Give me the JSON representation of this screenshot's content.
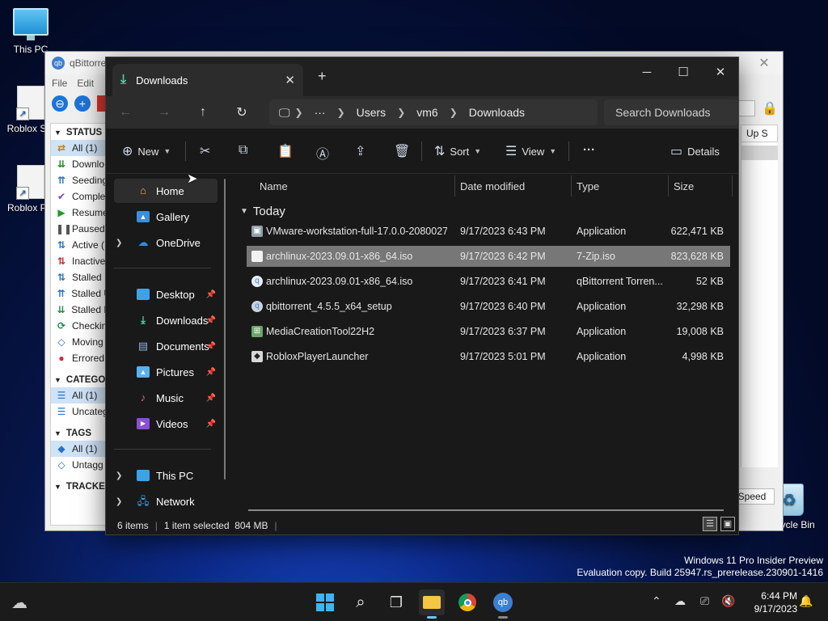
{
  "desktop": {
    "icons": [
      {
        "label": "This PC"
      },
      {
        "label": "Roblox Stu"
      },
      {
        "label": "Roblox Pla"
      },
      {
        "label": "Recycle Bin"
      }
    ],
    "watermark_line1": "Windows 11 Pro Insider Preview",
    "watermark_line2": "Evaluation copy. Build 25947.rs_prerelease.230901-1416"
  },
  "qbittorrent": {
    "title": "qBittorre",
    "menu": [
      "File",
      "Edit"
    ],
    "right_header": "Up S",
    "speed_button": "Speed",
    "sections": {
      "status": "STATUS",
      "categories": "CATEGO",
      "tags": "TAGS",
      "trackers": "TRACKER"
    },
    "status_items": [
      "All (1)",
      "Downlo",
      "Seeding",
      "Comple",
      "Resume",
      "Paused",
      "Active (",
      "Inactive",
      "Stalled",
      "Stalled U",
      "Stalled D",
      "Checkin",
      "Moving",
      "Errored"
    ],
    "category_items": [
      "All (1)",
      "Uncateg"
    ],
    "tag_items": [
      "All (1)",
      "Untagg"
    ]
  },
  "explorer": {
    "tab_title": "Downloads",
    "address": [
      "Users",
      "vm6",
      "Downloads"
    ],
    "address_more": "···",
    "search_placeholder": "Search Downloads",
    "commands": {
      "new": "New",
      "sort": "Sort",
      "view": "View",
      "more": "···",
      "details": "Details"
    },
    "nav": {
      "home": "Home",
      "gallery": "Gallery",
      "onedrive": "OneDrive",
      "desktop": "Desktop",
      "downloads": "Downloads",
      "documents": "Documents",
      "pictures": "Pictures",
      "music": "Music",
      "videos": "Videos",
      "thispc": "This PC",
      "network": "Network"
    },
    "columns": {
      "name": "Name",
      "date": "Date modified",
      "type": "Type",
      "size": "Size"
    },
    "group": "Today",
    "files": [
      {
        "name": "VMware-workstation-full-17.0.0-20800274",
        "date": "9/17/2023 6:43 PM",
        "type": "Application",
        "size": "622,471 KB"
      },
      {
        "name": "archlinux-2023.09.01-x86_64.iso",
        "date": "9/17/2023 6:42 PM",
        "type": "7-Zip.iso",
        "size": "823,628 KB"
      },
      {
        "name": "archlinux-2023.09.01-x86_64.iso",
        "date": "9/17/2023 6:41 PM",
        "type": "qBittorrent Torren...",
        "size": "52 KB"
      },
      {
        "name": "qbittorrent_4.5.5_x64_setup",
        "date": "9/17/2023 6:40 PM",
        "type": "Application",
        "size": "32,298 KB"
      },
      {
        "name": "MediaCreationTool22H2",
        "date": "9/17/2023 6:37 PM",
        "type": "Application",
        "size": "19,008 KB"
      },
      {
        "name": "RobloxPlayerLauncher",
        "date": "9/17/2023 5:01 PM",
        "type": "Application",
        "size": "4,998 KB"
      }
    ],
    "status": {
      "count": "6 items",
      "selection": "1 item selected  804 MB"
    }
  },
  "taskbar": {
    "time": "6:44 PM",
    "date": "9/17/2023"
  },
  "colors": {
    "accent": "#60cdff",
    "downloads_green": "#4bd1a6",
    "qbt_blue": "#1d73d6"
  }
}
